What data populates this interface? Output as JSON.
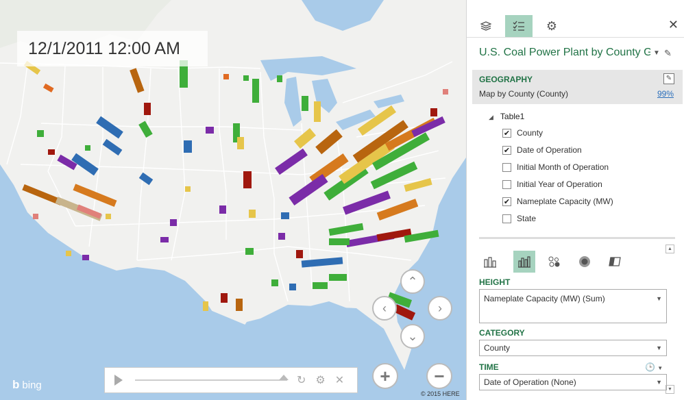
{
  "map": {
    "timestamp": "12/1/2011 12:00 AM",
    "bing_label": "bing",
    "copyright": "© 2015 HERE",
    "nav": {
      "up": "⌃",
      "left": "‹",
      "right": "›",
      "down": "⌄"
    },
    "zoom": {
      "in": "+",
      "out": "−"
    },
    "player": {
      "play_icon": "play-icon",
      "refresh_icon": "refresh-icon",
      "settings_icon": "gear-icon",
      "close_icon": "close-icon",
      "progress": 1.0
    },
    "colors": {
      "water": "#a9cbe9",
      "land": "#f1f1ef",
      "borders": "#ffffff"
    }
  },
  "pane": {
    "tabs": [
      "layers-icon",
      "field-list-icon",
      "gear-icon"
    ],
    "active_tab": 1,
    "close_label": "✕",
    "layer_title": "U.S. Coal Power Plant by County Gro",
    "geography": {
      "heading": "GEOGRAPHY",
      "mapping": "Map by County (County)",
      "confidence": "99%"
    },
    "table": {
      "name": "Table1",
      "fields": [
        {
          "label": "County",
          "checked": true
        },
        {
          "label": "Date of Operation",
          "checked": true
        },
        {
          "label": "Initial Month of Operation",
          "checked": false
        },
        {
          "label": "Initial Year of Operation",
          "checked": false
        },
        {
          "label": "Nameplate Capacity (MW)",
          "checked": true
        },
        {
          "label": "State",
          "checked": false
        }
      ]
    },
    "viz_types": [
      "stacked-column-icon",
      "clustered-column-icon",
      "bubble-icon",
      "heat-map-icon",
      "region-icon"
    ],
    "active_viz": 1,
    "height": {
      "label": "HEIGHT",
      "value": "Nameplate Capacity (MW) (Sum)"
    },
    "category": {
      "label": "CATEGORY",
      "value": "County"
    },
    "time": {
      "label": "TIME",
      "value": "Date of Operation (None)"
    }
  }
}
